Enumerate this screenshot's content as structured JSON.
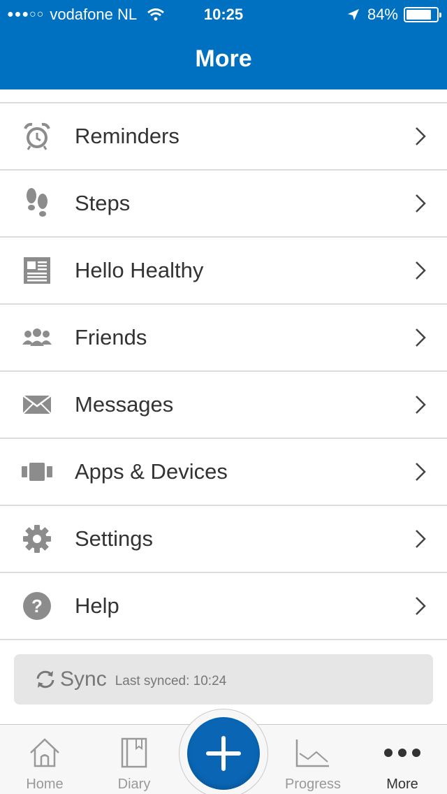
{
  "status_bar": {
    "signal_dots": "●●●○○",
    "carrier": "vodafone NL",
    "time": "10:25",
    "battery": "84%",
    "battery_level": 0.84
  },
  "header": {
    "title": "More"
  },
  "menu": {
    "items": [
      {
        "label": "Reminders",
        "icon": "alarm-clock-icon"
      },
      {
        "label": "Steps",
        "icon": "footprints-icon"
      },
      {
        "label": "Hello Healthy",
        "icon": "newspaper-icon"
      },
      {
        "label": "Friends",
        "icon": "friends-icon"
      },
      {
        "label": "Messages",
        "icon": "envelope-icon"
      },
      {
        "label": "Apps & Devices",
        "icon": "devices-icon"
      },
      {
        "label": "Settings",
        "icon": "gear-icon"
      },
      {
        "label": "Help",
        "icon": "help-icon"
      }
    ]
  },
  "sync": {
    "label": "Sync",
    "last_synced": "Last synced: 10:24"
  },
  "tab_bar": {
    "tabs": [
      {
        "label": "Home",
        "icon": "home-icon"
      },
      {
        "label": "Diary",
        "icon": "diary-icon"
      },
      {
        "label": "Progress",
        "icon": "progress-chart-icon"
      },
      {
        "label": "More",
        "icon": "more-dots-icon"
      }
    ],
    "active": "More"
  },
  "colors": {
    "brand": "#0070c0",
    "icon_gray": "#8c8c8c",
    "text": "#333333"
  }
}
